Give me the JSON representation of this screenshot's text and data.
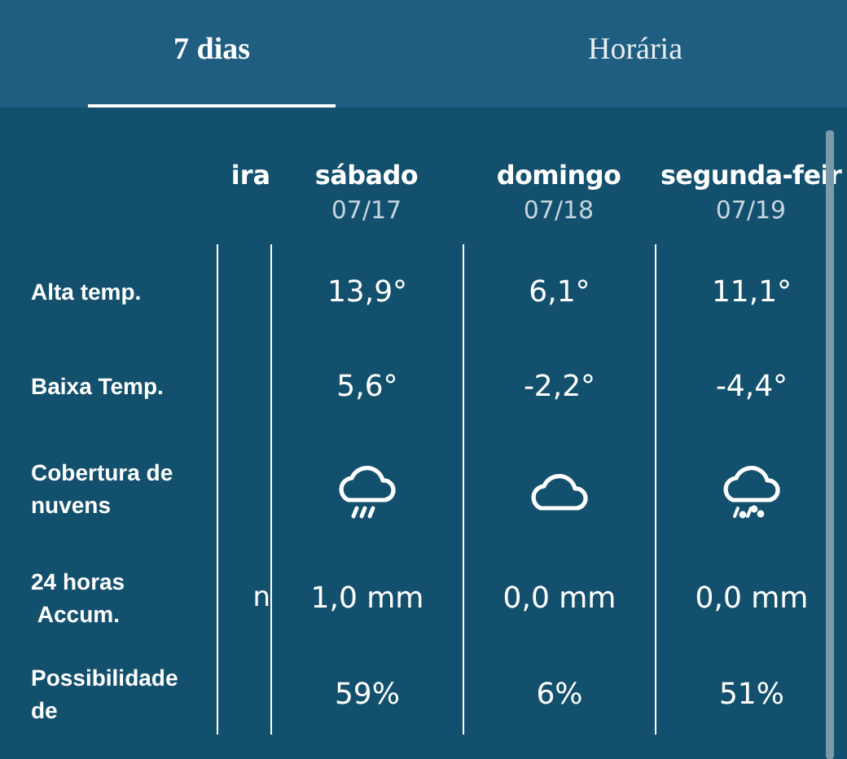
{
  "tabs": [
    {
      "label": "7 dias",
      "selected": true
    },
    {
      "label": "Horária",
      "selected": false
    }
  ],
  "row_labels": [
    "Alta temp.",
    "Baixa Temp.",
    "Cobertura de nuvens",
    "24 horas\n Accum.",
    "Possibilidade de"
  ],
  "partial_column": {
    "day": "ira",
    "accum": "n"
  },
  "days": [
    {
      "name": "sábado",
      "date": "07/17",
      "high": "13,9°",
      "low": "5,6°",
      "kind": "rain",
      "accum": "1,0 mm",
      "chance": "59%"
    },
    {
      "name": "domingo",
      "date": "07/18",
      "high": "6,1°",
      "low": "-2,2°",
      "kind": "cloud",
      "accum": "0,0 mm",
      "chance": "6%"
    },
    {
      "name": "segunda-feir",
      "date": "07/19",
      "high": "11,1°",
      "low": "-4,4°",
      "kind": "sleet",
      "accum": "0,0 mm",
      "chance": "51%"
    }
  ]
}
